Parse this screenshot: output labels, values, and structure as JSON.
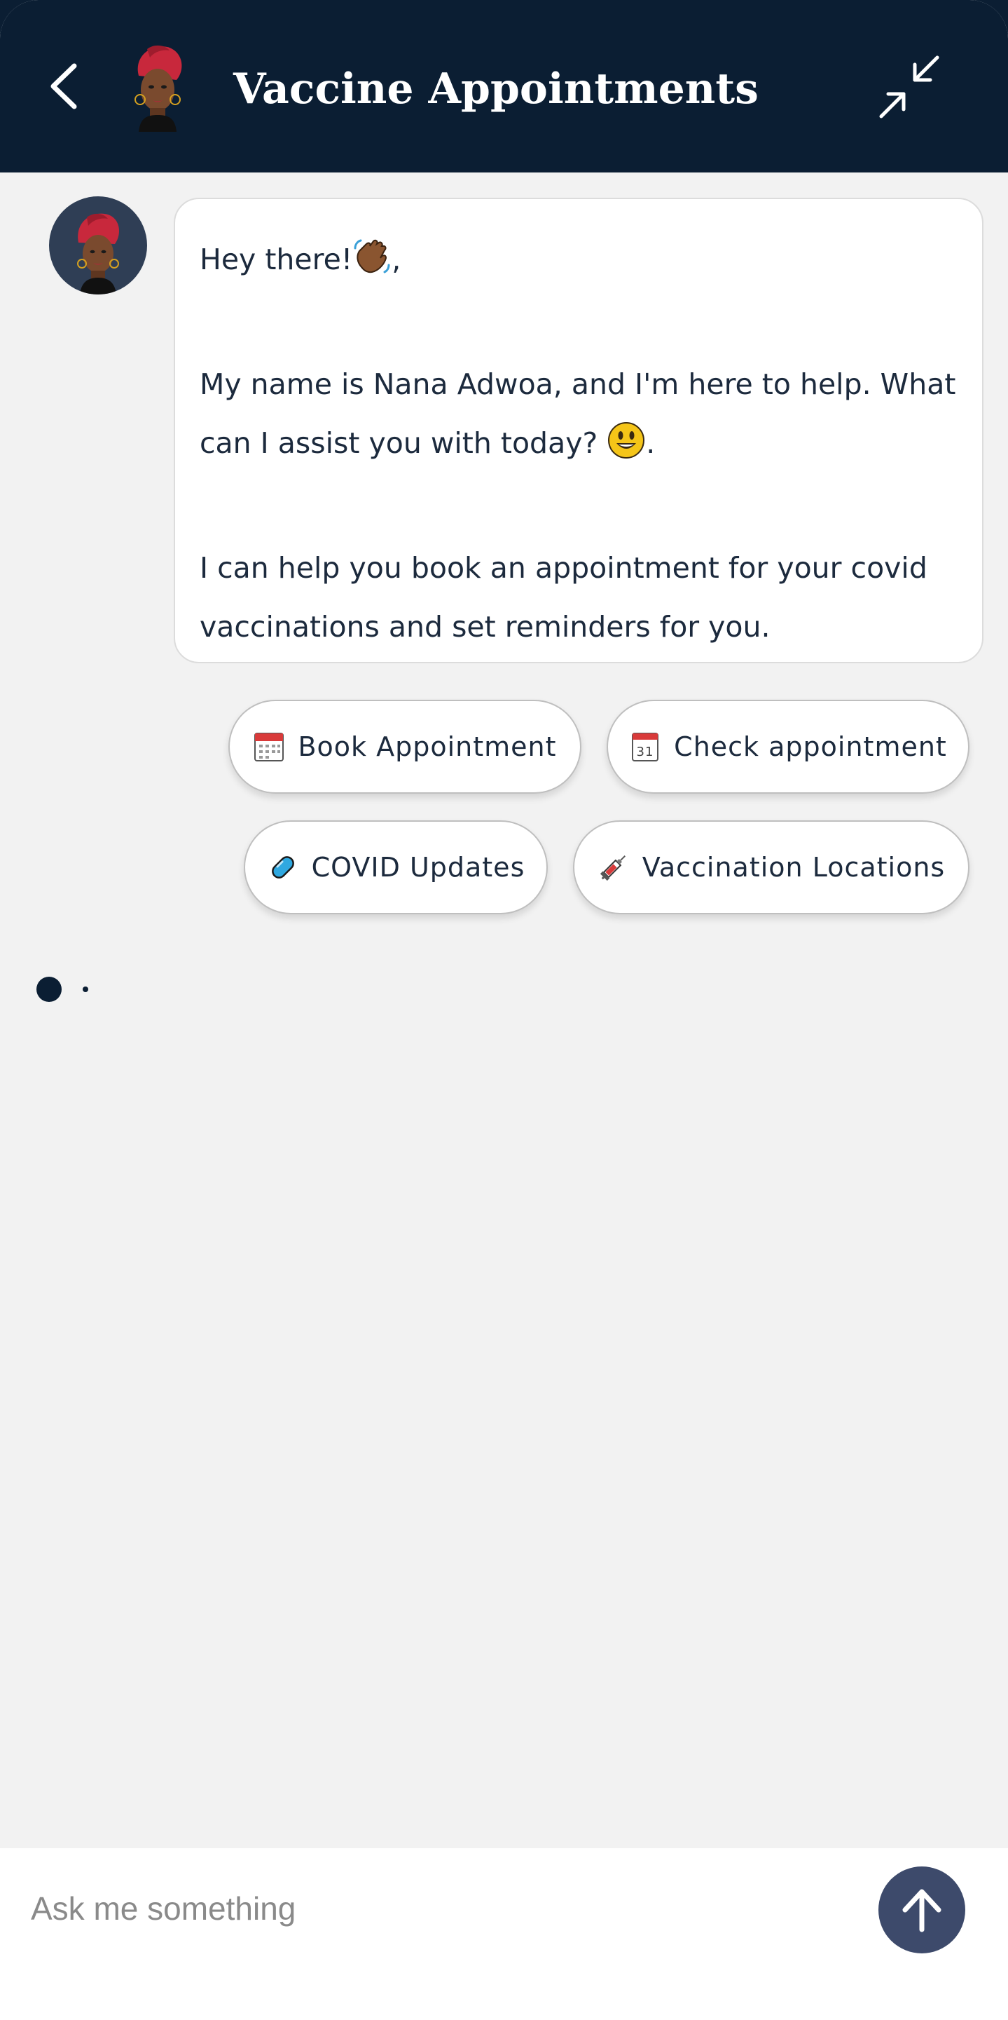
{
  "header": {
    "title": "Vaccine Appointments",
    "back_icon": "chevron-left-icon",
    "minimize_icon": "minimize-arrows-icon"
  },
  "bot": {
    "avatar": "bot-avatar",
    "messages": [
      {
        "lines": [
          "Hey there!",
          ",",
          "My name is Nana Adwoa, and I'm here to help. What",
          "can I assist you with today?",
          ".",
          "I can help you book an appointment for your covid",
          "vaccinations and set reminders for you."
        ],
        "emojis": [
          "waving-hand-icon",
          "smiling-face-icon"
        ]
      }
    ]
  },
  "quick_replies": [
    {
      "label": "Book Appointment",
      "icon": "calendar-icon"
    },
    {
      "label": "Check appointment",
      "icon": "calendar-31-icon"
    },
    {
      "label": "COVID Updates",
      "icon": "pill-icon"
    },
    {
      "label": "Vaccination Locations",
      "icon": "syringe-icon"
    }
  ],
  "composer": {
    "placeholder": "Ask me something",
    "send_icon": "arrow-up-icon"
  },
  "colors": {
    "header_bg": "#0b1e33",
    "body_bg": "#f2f2f2",
    "accent": "#3d4a6b",
    "text": "#1c2a3d"
  }
}
